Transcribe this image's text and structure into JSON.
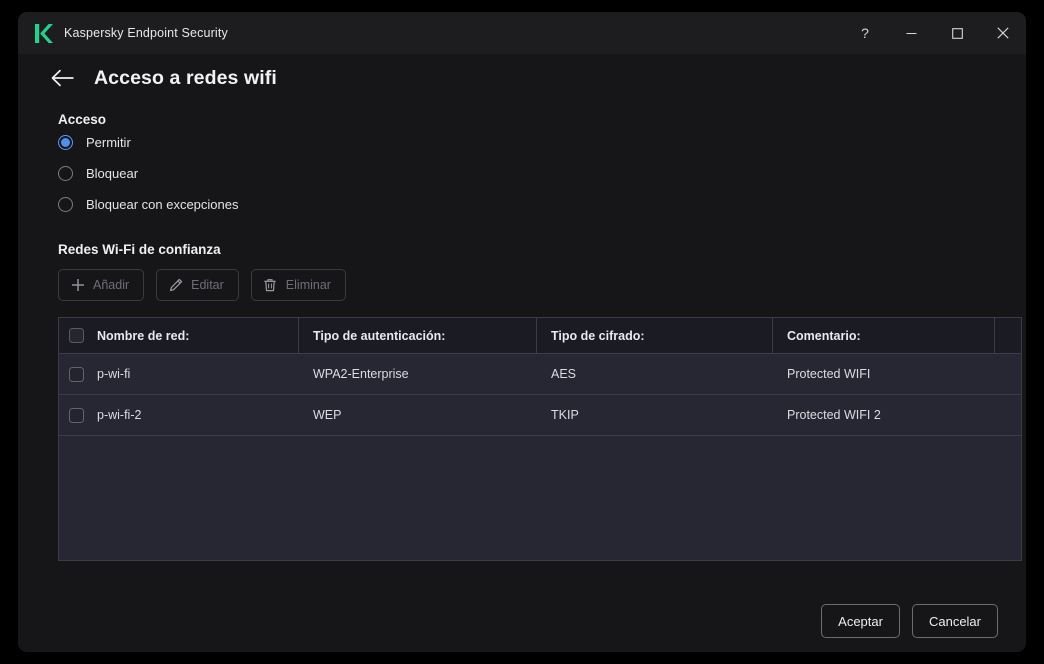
{
  "window": {
    "app_title": "Kaspersky Endpoint Security",
    "logo_color": "#23d18b",
    "controls": {
      "help": "?",
      "minimize": "—",
      "maximize": "□",
      "close": "✕"
    }
  },
  "page": {
    "back_icon": "arrow-left-icon",
    "title": "Acceso a redes wifi"
  },
  "access": {
    "section_title": "Acceso",
    "accent_color": "#4e90f0",
    "options": [
      {
        "label": "Permitir",
        "selected": true
      },
      {
        "label": "Bloquear",
        "selected": false
      },
      {
        "label": "Bloquear con excepciones",
        "selected": false
      }
    ]
  },
  "trusted_networks": {
    "section_title": "Redes Wi-Fi de confianza",
    "toolbar": [
      {
        "label": "Añadir",
        "icon": "plus-icon",
        "disabled": true
      },
      {
        "label": "Editar",
        "icon": "pencil-icon",
        "disabled": true
      },
      {
        "label": "Eliminar",
        "icon": "trash-icon",
        "disabled": true
      }
    ],
    "columns": [
      "Nombre de red:",
      "Tipo de autenticación:",
      "Tipo de cifrado:",
      "Comentario:"
    ],
    "rows": [
      {
        "checked": false,
        "name": "p-wi-fi",
        "auth": "WPA2-Enterprise",
        "cipher": "AES",
        "comment": "Protected WIFI"
      },
      {
        "checked": false,
        "name": "p-wi-fi-2",
        "auth": "WEP",
        "cipher": "TKIP",
        "comment": "Protected WIFI 2"
      }
    ]
  },
  "footer": {
    "accept": "Aceptar",
    "cancel": "Cancelar"
  }
}
